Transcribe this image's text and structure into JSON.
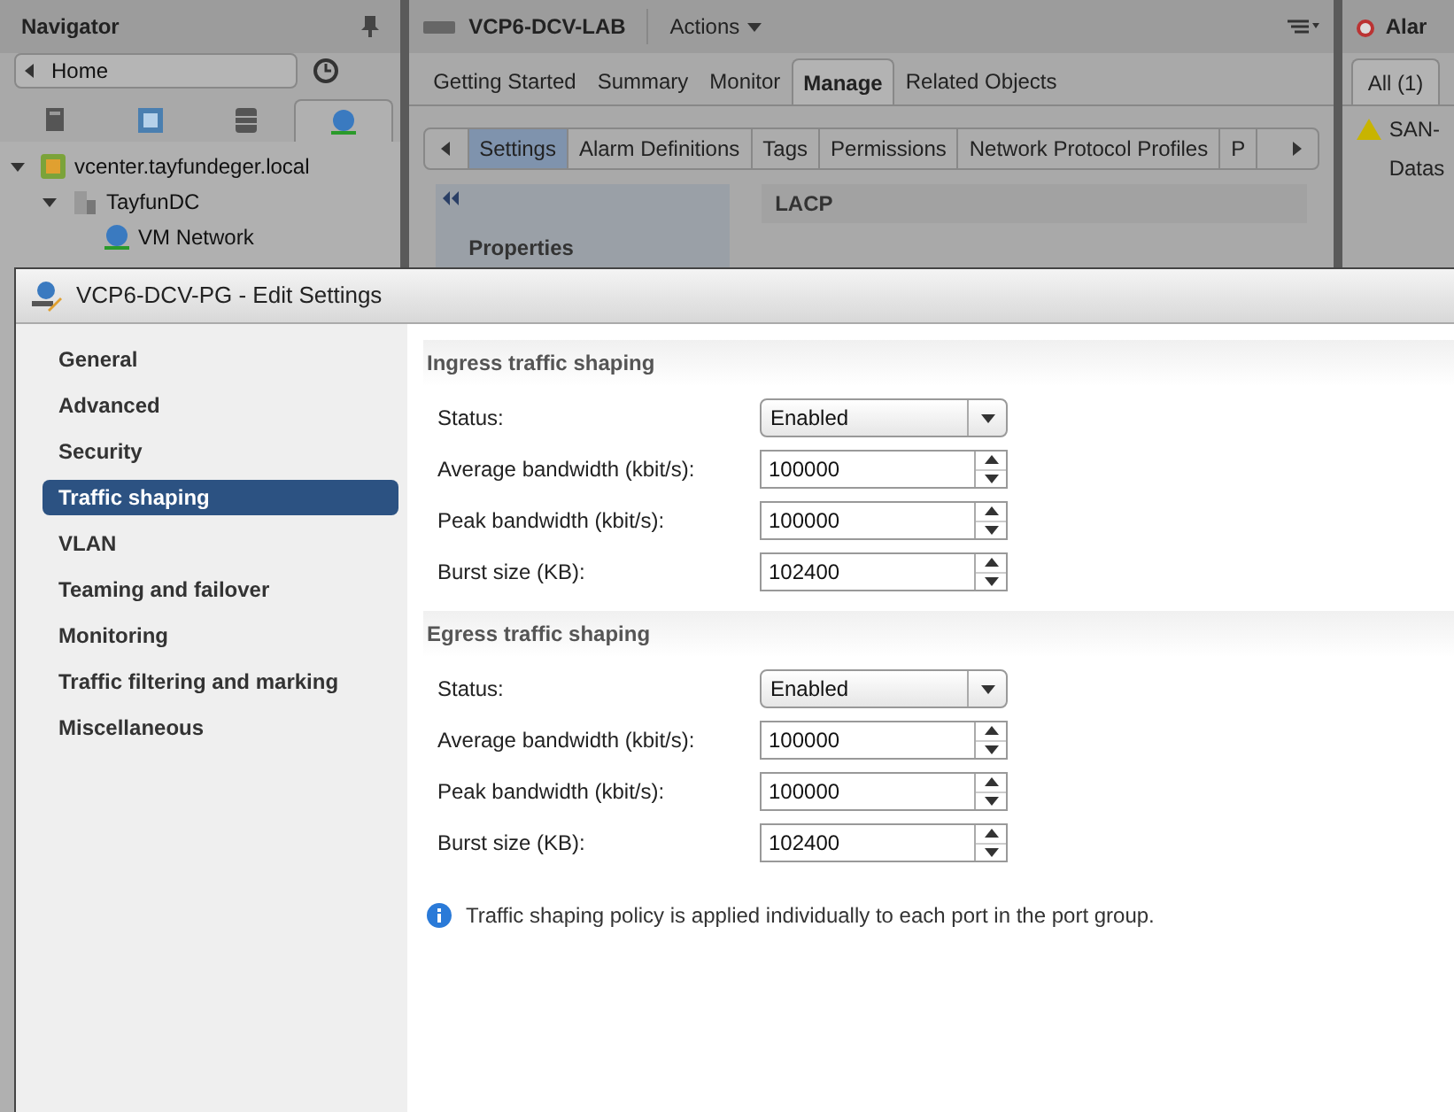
{
  "navigator": {
    "title": "Navigator",
    "home": "Home",
    "tabs": [
      {
        "selected": false
      },
      {
        "selected": false
      },
      {
        "selected": false
      },
      {
        "selected": true
      }
    ],
    "tree": [
      {
        "label": "vcenter.tayfundeger.local",
        "expanded": true,
        "children": [
          {
            "label": "TayfunDC",
            "expanded": true,
            "children": [
              {
                "label": "VM Network"
              }
            ]
          }
        ]
      }
    ]
  },
  "center": {
    "title": "VCP6-DCV-LAB",
    "actions": "Actions",
    "tabs": [
      {
        "label": "Getting Started",
        "selected": false
      },
      {
        "label": "Summary",
        "selected": false
      },
      {
        "label": "Monitor",
        "selected": false
      },
      {
        "label": "Manage",
        "selected": true
      },
      {
        "label": "Related Objects",
        "selected": false
      }
    ],
    "subtabs": [
      {
        "label": "Settings",
        "selected": true
      },
      {
        "label": "Alarm Definitions",
        "selected": false
      },
      {
        "label": "Tags",
        "selected": false
      },
      {
        "label": "Permissions",
        "selected": false
      },
      {
        "label": "Network Protocol Profiles",
        "selected": false
      },
      {
        "label": "P",
        "selected": false
      }
    ],
    "side_heading": "Properties",
    "section_title": "LACP"
  },
  "alarms": {
    "title": "Alar",
    "tab": "All (1)",
    "item": "SAN-",
    "item_detail": "Datas"
  },
  "dialog": {
    "title": "VCP6-DCV-PG - Edit Settings",
    "nav": [
      {
        "label": "General",
        "selected": false
      },
      {
        "label": "Advanced",
        "selected": false
      },
      {
        "label": "Security",
        "selected": false
      },
      {
        "label": "Traffic shaping",
        "selected": true
      },
      {
        "label": "VLAN",
        "selected": false
      },
      {
        "label": "Teaming and failover",
        "selected": false
      },
      {
        "label": "Monitoring",
        "selected": false
      },
      {
        "label": "Traffic filtering and marking",
        "selected": false
      },
      {
        "label": "Miscellaneous",
        "selected": false
      }
    ],
    "sections": [
      {
        "title": "Ingress traffic shaping",
        "fields": [
          {
            "kind": "select",
            "label": "Status:",
            "value": "Enabled"
          },
          {
            "kind": "spinner",
            "label": "Average bandwidth (kbit/s):",
            "value": "100000"
          },
          {
            "kind": "spinner",
            "label": "Peak bandwidth (kbit/s):",
            "value": "100000"
          },
          {
            "kind": "spinner",
            "label": "Burst size (KB):",
            "value": "102400"
          }
        ]
      },
      {
        "title": "Egress traffic shaping",
        "fields": [
          {
            "kind": "select",
            "label": "Status:",
            "value": "Enabled"
          },
          {
            "kind": "spinner",
            "label": "Average bandwidth (kbit/s):",
            "value": "100000"
          },
          {
            "kind": "spinner",
            "label": "Peak bandwidth (kbit/s):",
            "value": "100000"
          },
          {
            "kind": "spinner",
            "label": "Burst size (KB):",
            "value": "102400"
          }
        ]
      }
    ],
    "note": "Traffic shaping policy is applied individually to each port in the port group."
  }
}
